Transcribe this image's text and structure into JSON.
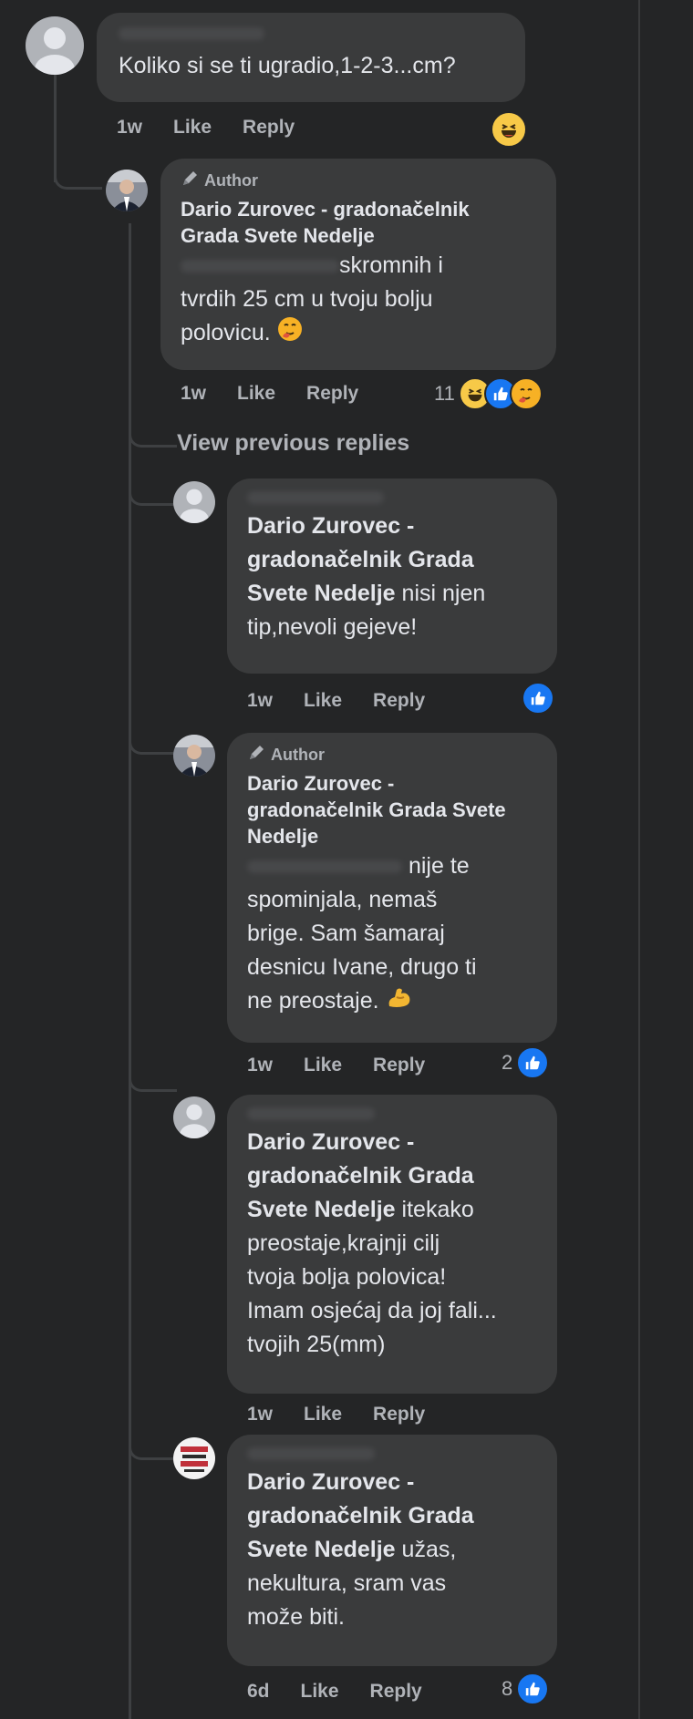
{
  "comments": [
    {
      "text": "Koliko si se ti ugradio,1-2-3...cm?",
      "time": "1w",
      "like": "Like",
      "reply": "Reply"
    },
    {
      "author_badge": "Author",
      "name_line1": "Dario Zurovec - gradonačelnik",
      "name_line2": "Grada Svete Nedelje",
      "text_line1": "skromnih i",
      "text_line2": "tvrdih 25 cm u tvoju bolju",
      "text_line3": "polovicu.",
      "time": "1w",
      "like": "Like",
      "reply": "Reply",
      "reaction_count": "11"
    },
    {
      "view_previous": "View previous replies"
    },
    {
      "mention_line1": "Dario Zurovec -",
      "mention_line2": "gradonačelnik Grada",
      "mention_line3": "Svete Nedelje",
      "text_line3": "nisi njen",
      "text_line4": "tip,nevoli gejeve!",
      "time": "1w",
      "like": "Like",
      "reply": "Reply"
    },
    {
      "author_badge": "Author",
      "name_line1": "Dario Zurovec -",
      "name_line2": "gradonačelnik Grada Svete",
      "name_line3": "Nedelje",
      "text_line1": "nije te",
      "text_line2": "spominjala, nemaš",
      "text_line3": "brige. Sam šamaraj",
      "text_line4": "desnicu Ivane, drugo ti",
      "text_line5": "ne preostaje.",
      "time": "1w",
      "like": "Like",
      "reply": "Reply",
      "reaction_count": "2"
    },
    {
      "mention_line1": "Dario Zurovec -",
      "mention_line2": "gradonačelnik Grada",
      "mention_line3": "Svete Nedelje",
      "text_line3": "itekako",
      "text_line4": "preostaje,krajnji cilj",
      "text_line5": "tvoja bolja polovica!",
      "text_line6": "Imam osjećaj da joj fali...",
      "text_line7": "tvojih 25(mm)",
      "time": "1w",
      "like": "Like",
      "reply": "Reply"
    },
    {
      "mention_line1": "Dario Zurovec -",
      "mention_line2": "gradonačelnik Grada",
      "mention_line3": "Svete Nedelje",
      "text_line3": "užas,",
      "text_line4": "nekultura, sram vas",
      "text_line5": "može biti.",
      "time": "6d",
      "like": "Like",
      "reply": "Reply",
      "reaction_count": "8"
    }
  ],
  "colors": {
    "background": "#242526",
    "bubble": "#3a3b3c",
    "text": "#e4e6eb",
    "muted": "#b0b3b8",
    "like_blue": "#1877f2"
  },
  "icons": {
    "default_avatar": "default-avatar-icon",
    "author_badge": "pencil-icon",
    "like_reaction": "thumbs-up-icon",
    "haha_reaction": "laughing-face-icon",
    "care_reaction": "care-face-icon"
  }
}
